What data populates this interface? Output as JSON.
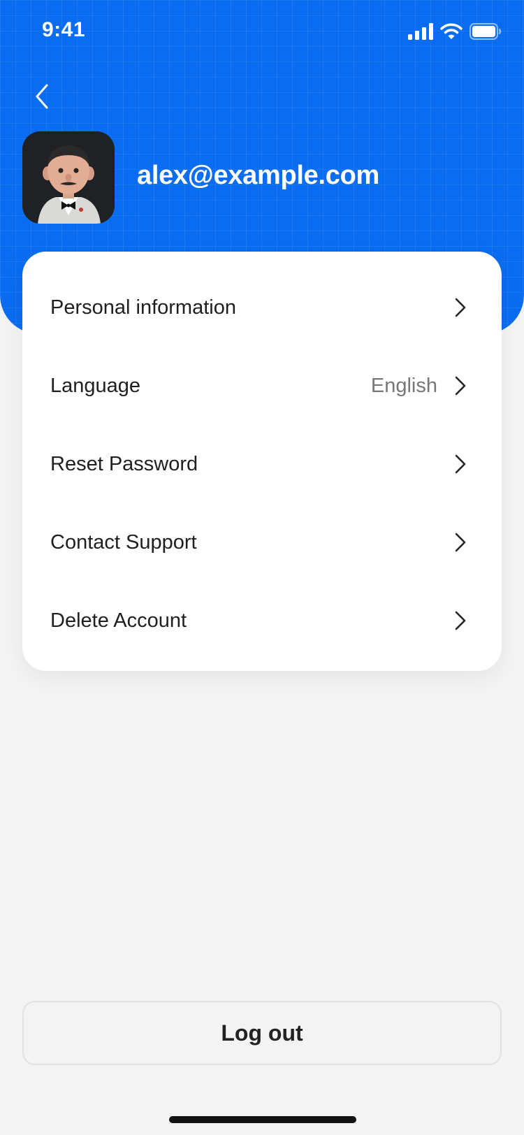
{
  "status_bar": {
    "time": "9:41"
  },
  "profile": {
    "email": "alex@example.com"
  },
  "menu": {
    "items": [
      {
        "label": "Personal information",
        "value": ""
      },
      {
        "label": "Language",
        "value": "English"
      },
      {
        "label": "Reset Password",
        "value": ""
      },
      {
        "label": "Contact Support",
        "value": ""
      },
      {
        "label": "Delete Account",
        "value": ""
      }
    ]
  },
  "logout": {
    "label": "Log out"
  },
  "colors": {
    "accent": "#0a6cf0",
    "background": "#f3f3f3",
    "card": "#ffffff"
  },
  "icons": {
    "back": "chevron-left-icon",
    "row": "chevron-right-icon",
    "signal": "cellular-signal-icon",
    "wifi": "wifi-icon",
    "battery": "battery-icon"
  }
}
